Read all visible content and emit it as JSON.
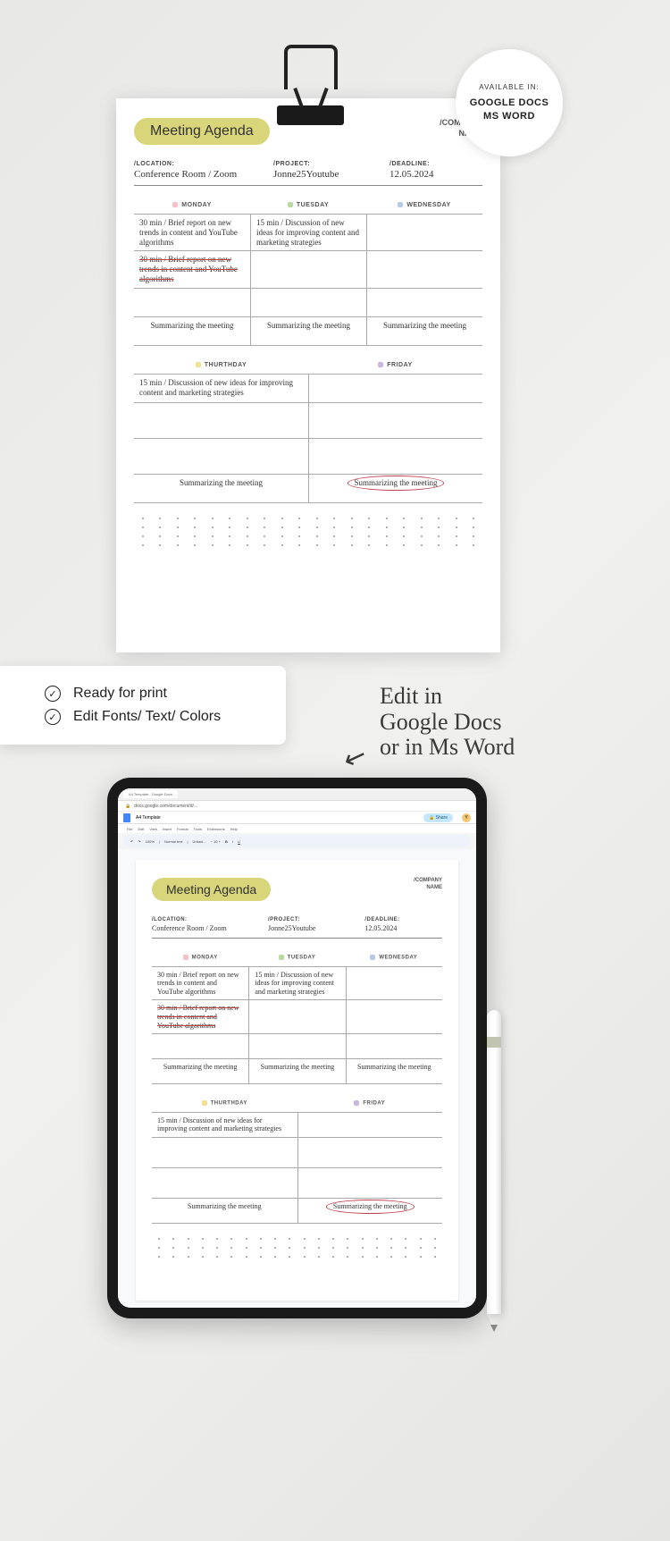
{
  "badge": {
    "available": "AVAILABLE IN:",
    "apps": "GOOGLE DOCS\nMS WORD"
  },
  "agenda": {
    "title": "Meeting Agenda",
    "company_label": "/COMPANY",
    "company_name": "NAME",
    "location_label": "/LOCATION:",
    "location": "Conference Room / Zoom",
    "project_label": "/PROJECT:",
    "project": "Jonne25Youtube",
    "deadline_label": "/DEADLINE:",
    "deadline": "12.05.2024",
    "days1": [
      "MONDAY",
      "TUESDAY",
      "WEDNESDAY"
    ],
    "days2": [
      "THURTHDAY",
      "FRIDAY"
    ],
    "mon_1": "30 min / Brief report on new trends in content and YouTube algorithms",
    "mon_2": "30 min / Brief report on new trends in content and YouTube algorithms",
    "tue_1": "15 min / Discussion of new ideas for improving content and marketing strategies",
    "summary": "Summarizing the meeting",
    "thu_1": "15 min / Discussion of new ideas for improving content and marketing strategies"
  },
  "features": {
    "f1": "Ready for print",
    "f2": "Edit Fonts/ Text/ Colors"
  },
  "annotation": {
    "text": "Edit in\nGoogle Docs\nor in Ms Word"
  },
  "gdocs": {
    "doc_title": "A4 Template",
    "url": "docs.google.com/document/d/...",
    "menu": [
      "File",
      "Edit",
      "View",
      "Insert",
      "Format",
      "Tools",
      "Extensions",
      "Help"
    ],
    "share": "Share"
  },
  "colors": {
    "pill": "#d8d57a",
    "strike": "#c04040",
    "circle": "#c04050"
  }
}
